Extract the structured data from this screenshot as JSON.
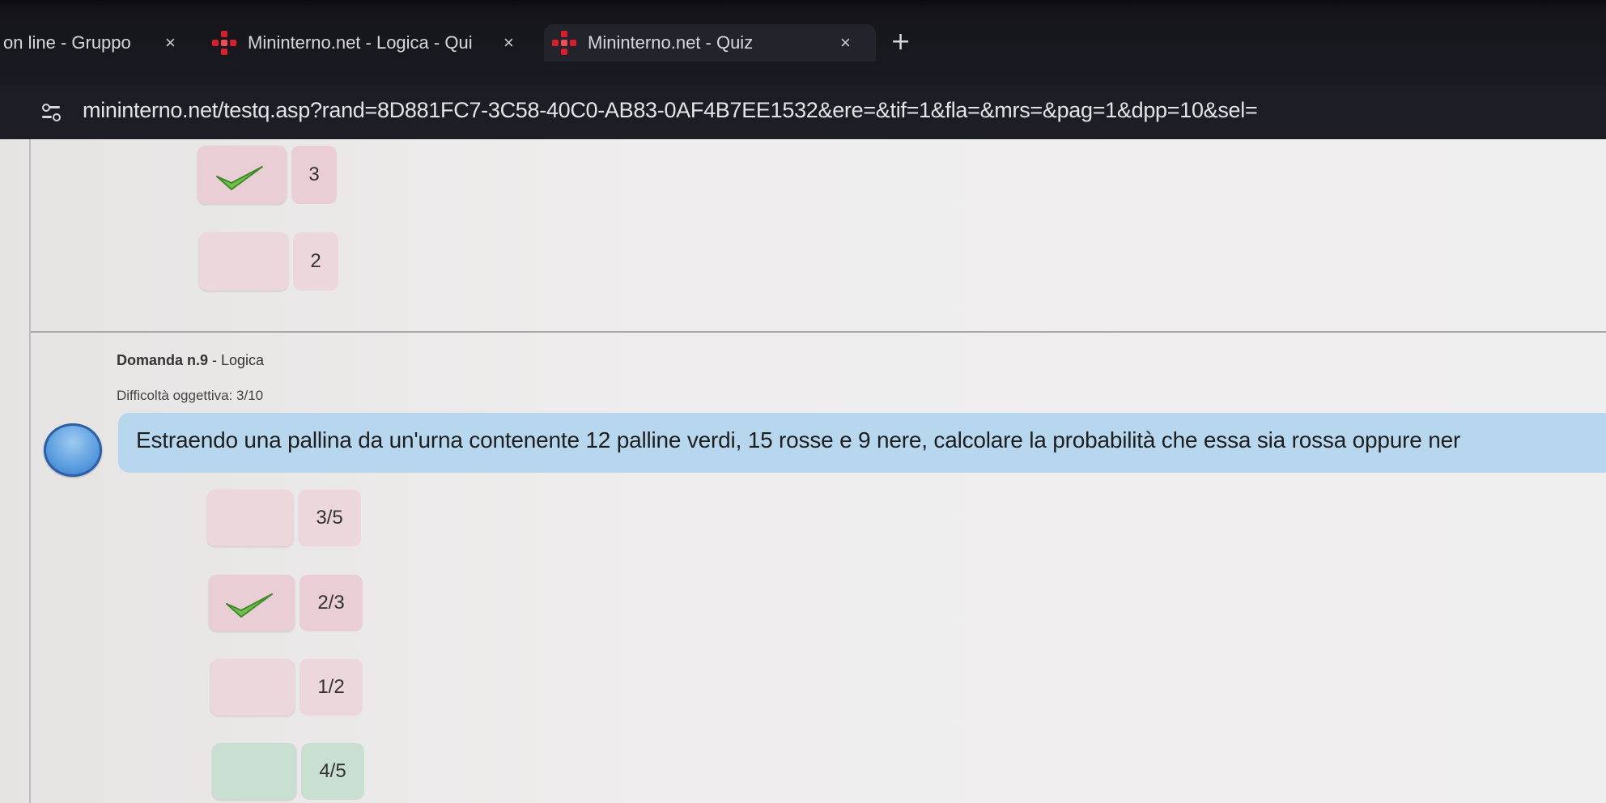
{
  "browser": {
    "tabs": [
      {
        "title": "on line - Gruppo",
        "close": "×"
      },
      {
        "title": "Mininterno.net - Logica - Qui",
        "close": "×"
      },
      {
        "title": "Mininterno.net - Quiz",
        "close": "×"
      }
    ],
    "new_tab": "+",
    "url": "mininterno.net/testq.asp?rand=8D881FC7-3C58-40C0-AB83-0AF4B7EE1532&ere=&tif=1&fla=&mrs=&pag=1&dpp=10&sel=",
    "site_icon": "tune-icon"
  },
  "previous_question": {
    "answers": [
      {
        "label": "3",
        "selected": true,
        "icon": "checkmark-icon"
      },
      {
        "label": "2",
        "selected": false
      }
    ]
  },
  "question": {
    "title_prefix": "Domanda n.9",
    "title_suffix": " - Logica",
    "difficulty": "Difficoltà oggettiva: 3/10",
    "text": "Estraendo una pallina da un'urna contenente 12 palline verdi, 15 rosse e 9 nere, calcolare la probabilità che essa sia rossa oppure ner",
    "answers": [
      {
        "label": "3/5",
        "selected": false
      },
      {
        "label": "2/3",
        "selected": true,
        "icon": "checkmark-icon"
      },
      {
        "label": "1/2",
        "selected": false
      },
      {
        "label": "4/5",
        "selected": false,
        "correct": true
      }
    ]
  },
  "colors": {
    "answer_box": "#e9ced5",
    "correct_box": "#c9dfd2",
    "question_bar": "#b6d7ee",
    "bubble": "#5b9ee0"
  }
}
